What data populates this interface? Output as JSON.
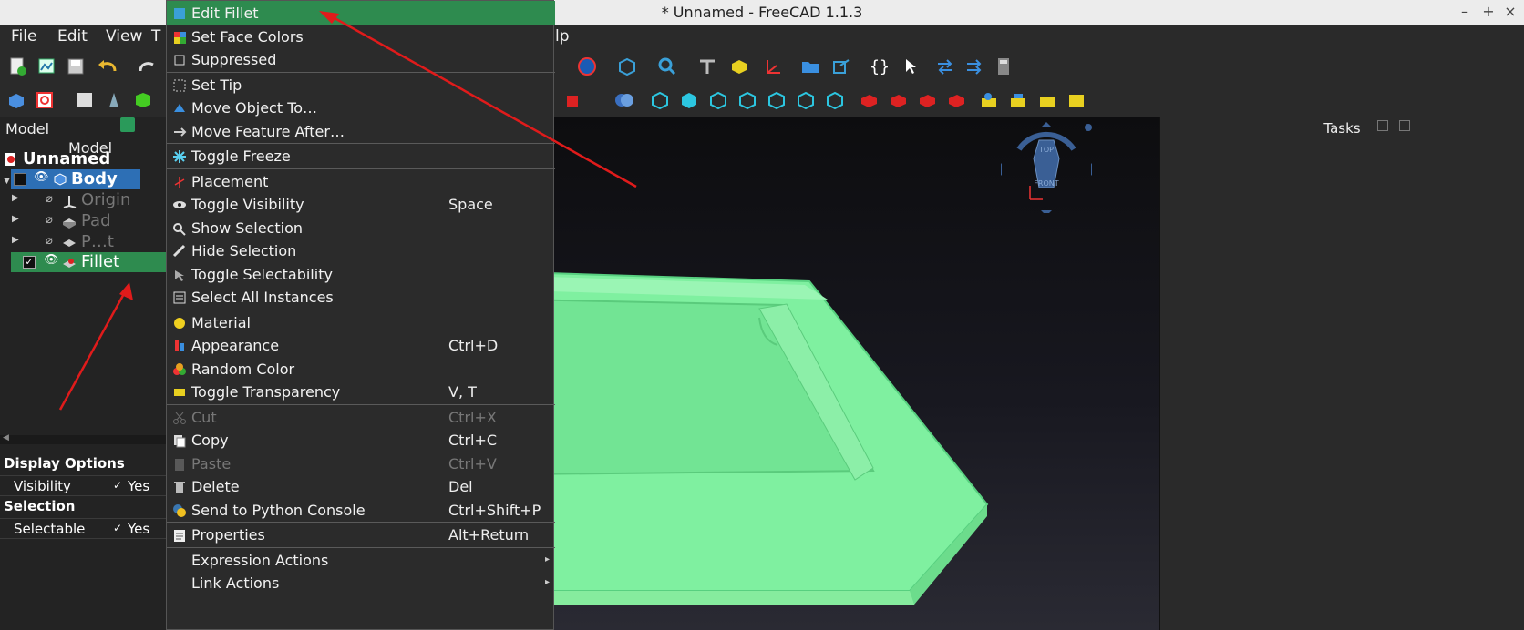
{
  "window": {
    "title": "* Unnamed - FreeCAD 1.1.3",
    "minimize": "–",
    "maximize": "+",
    "close": "×"
  },
  "menubar": [
    "File",
    "Edit",
    "View",
    "T",
    "lp"
  ],
  "model_panel": {
    "header": "Model",
    "column": "Model",
    "document": "Unnamed",
    "items": [
      {
        "label": "Body"
      },
      {
        "label": "Origin"
      },
      {
        "label": "Pad"
      },
      {
        "label": "P…t"
      },
      {
        "label": "Fillet"
      }
    ]
  },
  "properties": {
    "group1": "Display Options",
    "visibility_label": "Visibility",
    "visibility_value": "Yes",
    "group2": "Selection",
    "selectable_label": "Selectable",
    "selectable_value": "Yes"
  },
  "tasks": {
    "title": "Tasks"
  },
  "navcube": {
    "top": "TOP",
    "front": "FRONT"
  },
  "context_menu": [
    {
      "label": "Edit Fillet",
      "shortcut": "",
      "icon": "edit-icon",
      "highlight": true
    },
    {
      "label": "Set Face Colors",
      "shortcut": "",
      "icon": "face-colors-icon"
    },
    {
      "label": "Suppressed",
      "shortcut": "",
      "icon": "checkbox-icon"
    },
    {
      "sep": true
    },
    {
      "label": "Set Tip",
      "shortcut": "",
      "icon": "tip-icon"
    },
    {
      "label": "Move Object To…",
      "shortcut": "",
      "icon": "move-object-icon"
    },
    {
      "label": "Move Feature After…",
      "shortcut": "",
      "icon": "move-feature-icon"
    },
    {
      "sep": true
    },
    {
      "label": "Toggle Freeze",
      "shortcut": "",
      "icon": "freeze-icon"
    },
    {
      "sep": true
    },
    {
      "label": "Placement",
      "shortcut": "",
      "icon": "placement-icon"
    },
    {
      "label": "Toggle Visibility",
      "shortcut": "Space",
      "icon": "eye-icon"
    },
    {
      "label": "Show Selection",
      "shortcut": "",
      "icon": "show-selection-icon"
    },
    {
      "label": "Hide Selection",
      "shortcut": "",
      "icon": "hide-selection-icon"
    },
    {
      "label": "Toggle Selectability",
      "shortcut": "",
      "icon": "selectability-icon"
    },
    {
      "label": "Select All Instances",
      "shortcut": "",
      "icon": "select-instances-icon"
    },
    {
      "sep": true
    },
    {
      "label": "Material",
      "shortcut": "",
      "icon": "material-icon"
    },
    {
      "label": "Appearance",
      "shortcut": "Ctrl+D",
      "icon": "appearance-icon"
    },
    {
      "label": "Random Color",
      "shortcut": "",
      "icon": "random-color-icon"
    },
    {
      "label": "Toggle Transparency",
      "shortcut": "V, T",
      "icon": "transparency-icon"
    },
    {
      "sep": true
    },
    {
      "label": "Cut",
      "shortcut": "Ctrl+X",
      "icon": "cut-icon",
      "disabled": true
    },
    {
      "label": "Copy",
      "shortcut": "Ctrl+C",
      "icon": "copy-icon"
    },
    {
      "label": "Paste",
      "shortcut": "Ctrl+V",
      "icon": "paste-icon",
      "disabled": true
    },
    {
      "label": "Delete",
      "shortcut": "Del",
      "icon": "delete-icon"
    },
    {
      "label": "Send to Python Console",
      "shortcut": "Ctrl+Shift+P",
      "icon": "python-icon"
    },
    {
      "sep": true
    },
    {
      "label": "Properties",
      "shortcut": "Alt+Return",
      "icon": "properties-icon"
    },
    {
      "sep": true
    },
    {
      "label": "Expression Actions",
      "shortcut": "",
      "icon": "",
      "submenu": true
    },
    {
      "label": "Link Actions",
      "shortcut": "",
      "icon": "",
      "submenu": true
    }
  ],
  "colors": {
    "highlight": "#2e8b4f",
    "selected_blue": "#4a8fe0",
    "model_green": "#7ff0a0",
    "annotation": "#e01b1b"
  }
}
